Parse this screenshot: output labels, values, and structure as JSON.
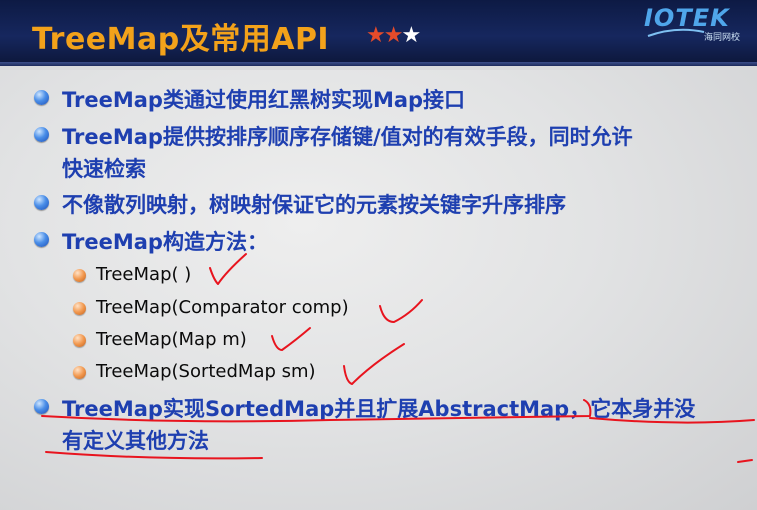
{
  "header": {
    "title": "TreeMap及常用API",
    "logo_text": "IOTEK",
    "logo_sub": "海同网校",
    "star_red": "★★",
    "star_white": "★"
  },
  "bullets": [
    {
      "line1": "TreeMap类通过使用红黑树实现Map接口"
    },
    {
      "line1": "TreeMap提供按排序顺序存储键/值对的有效手段，同时允许",
      "line2": "快速检索"
    },
    {
      "line1": "不像散列映射，树映射保证它的元素按关键字升序排序"
    },
    {
      "line1": "TreeMap构造方法："
    }
  ],
  "constructors": [
    "TreeMap( )",
    "TreeMap(Comparator comp)",
    "TreeMap(Map m)",
    "TreeMap(SortedMap sm)"
  ],
  "last_bullet": {
    "line1": "TreeMap实现SortedMap并且扩展AbstractMap，它本身并没",
    "line2": "有定义其他方法"
  },
  "colors": {
    "title": "#f3a21a",
    "bullet_text": "#1e3fb0",
    "annotation": "#e8141e"
  }
}
